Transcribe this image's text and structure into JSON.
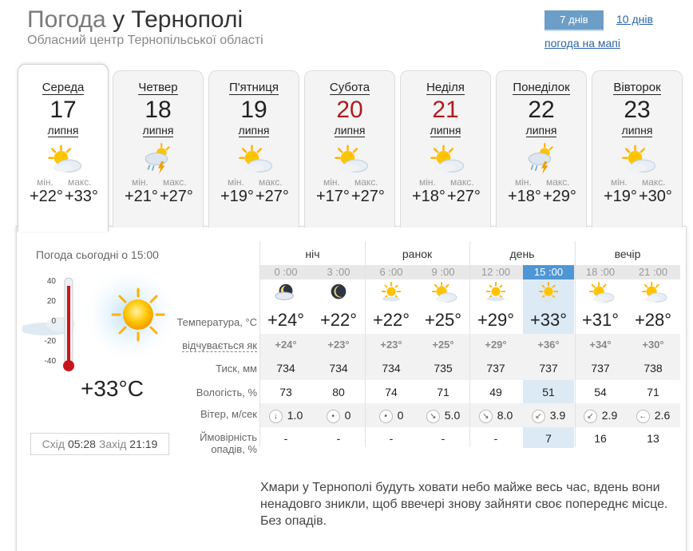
{
  "header": {
    "title_prefix": "Погода",
    "title_city": "у Тернополі",
    "subtitle": "Обласний центр Тернопільської області",
    "tab_7_days": "7 днів",
    "tab_10_days": "10 днів",
    "map_link": "погода на мапі"
  },
  "days": [
    {
      "name": "Середа",
      "date": "17",
      "month": "липня",
      "min_label": "мін.",
      "max_label": "макс.",
      "min": "+22°",
      "max": "+33°",
      "icon": "sun-cloud-icon",
      "red": false
    },
    {
      "name": "Четвер",
      "date": "18",
      "month": "липня",
      "min_label": "мін.",
      "max_label": "макс.",
      "min": "+21°",
      "max": "+27°",
      "icon": "thunderstorm-icon",
      "red": false
    },
    {
      "name": "П'ятниця",
      "date": "19",
      "month": "липня",
      "min_label": "мін.",
      "max_label": "макс.",
      "min": "+19°",
      "max": "+27°",
      "icon": "sun-cloud-icon",
      "red": false
    },
    {
      "name": "Субота",
      "date": "20",
      "month": "липня",
      "min_label": "мін.",
      "max_label": "макс.",
      "min": "+17°",
      "max": "+27°",
      "icon": "sun-cloud-icon",
      "red": true
    },
    {
      "name": "Неділя",
      "date": "21",
      "month": "липня",
      "min_label": "мін.",
      "max_label": "макс.",
      "min": "+18°",
      "max": "+27°",
      "icon": "sun-cloud-icon",
      "red": true
    },
    {
      "name": "Понеділок",
      "date": "22",
      "month": "липня",
      "min_label": "мін.",
      "max_label": "макс.",
      "min": "+18°",
      "max": "+29°",
      "icon": "thunderstorm-icon",
      "red": false
    },
    {
      "name": "Вівторок",
      "date": "23",
      "month": "липня",
      "min_label": "мін.",
      "max_label": "макс.",
      "min": "+19°",
      "max": "+30°",
      "icon": "sun-cloud-icon",
      "red": false
    }
  ],
  "now": {
    "label": "Погода сьогодні о 15:00",
    "temp": "+33°C",
    "scale": [
      "40",
      "20",
      "0",
      "-20",
      "-40"
    ],
    "sunrise_label": "Схід",
    "sunrise": "05:28",
    "sunset_label": "Захід",
    "sunset": "21:19"
  },
  "periods": [
    "ніч",
    "ранок",
    "день",
    "вечір"
  ],
  "row_labels": {
    "temp": "Температура, °С",
    "feels": "відчувається як",
    "pressure": "Тиск, мм",
    "humidity": "Вологість, %",
    "wind": "Вітер, м/сек",
    "precip_1": "Ймовірність",
    "precip_2": "опадів, %"
  },
  "hours": [
    {
      "time": "0 :00",
      "icon": "night-cloud-icon",
      "temp": "+24°",
      "feels": "+24°",
      "pressure": "734",
      "humidity": "73",
      "wind_dir": "↓",
      "wind": "1.0",
      "precip": "-"
    },
    {
      "time": "3 :00",
      "icon": "moon-icon",
      "temp": "+22°",
      "feels": "+23°",
      "pressure": "734",
      "humidity": "80",
      "wind_dir": "•",
      "wind": "0",
      "precip": "-"
    },
    {
      "time": "6 :00",
      "icon": "sun-icon",
      "temp": "+22°",
      "feels": "+23°",
      "pressure": "734",
      "humidity": "74",
      "wind_dir": "•",
      "wind": "0",
      "precip": "-"
    },
    {
      "time": "9 :00",
      "icon": "sun-cloud-icon",
      "temp": "+25°",
      "feels": "+25°",
      "pressure": "735",
      "humidity": "71",
      "wind_dir": "↘",
      "wind": "5.0",
      "precip": "-"
    },
    {
      "time": "12 :00",
      "icon": "sun-icon",
      "temp": "+29°",
      "feels": "+29°",
      "pressure": "737",
      "humidity": "49",
      "wind_dir": "↘",
      "wind": "8.0",
      "precip": "-"
    },
    {
      "time": "15 :00",
      "icon": "sun-icon",
      "temp": "+33°",
      "feels": "+36°",
      "pressure": "737",
      "humidity": "51",
      "wind_dir": "↙",
      "wind": "3.9",
      "precip": "7"
    },
    {
      "time": "18 :00",
      "icon": "sun-cloud-icon",
      "temp": "+31°",
      "feels": "+34°",
      "pressure": "737",
      "humidity": "54",
      "wind_dir": "↙",
      "wind": "2.9",
      "precip": "16"
    },
    {
      "time": "21 :00",
      "icon": "sun-cloud-icon",
      "temp": "+28°",
      "feels": "+30°",
      "pressure": "738",
      "humidity": "71",
      "wind_dir": "←",
      "wind": "2.6",
      "precip": "13"
    }
  ],
  "description": "Хмари у Тернополі будуть ховати небо майже весь час, вдень вони ненадовго зникли, щоб ввечері знову зайняти своє попереднє місце. Без опадів.",
  "colors": {
    "accent_blue": "#4f97d4",
    "tab_blue": "#6d9ec8",
    "link_blue": "#2a64a6",
    "weekend_red": "#b01c1c",
    "current_col": "#dceaf5"
  }
}
